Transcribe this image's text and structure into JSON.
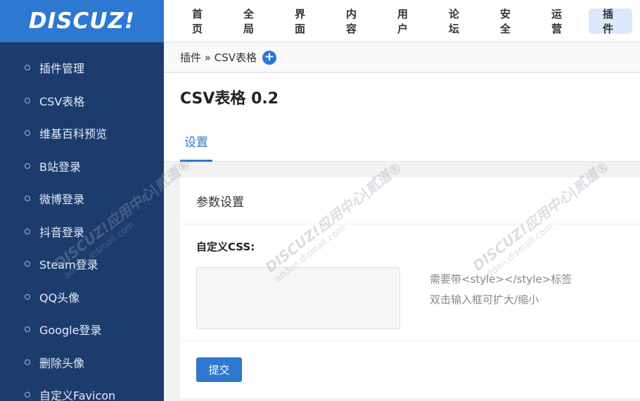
{
  "sidebar": {
    "logo": "DISCUZ!",
    "items": [
      {
        "label": "插件管理"
      },
      {
        "label": "CSV表格"
      },
      {
        "label": "维基百科预览"
      },
      {
        "label": "B站登录"
      },
      {
        "label": "微博登录"
      },
      {
        "label": "抖音登录"
      },
      {
        "label": "Steam登录"
      },
      {
        "label": "QQ头像"
      },
      {
        "label": "Google登录"
      },
      {
        "label": "删除头像"
      },
      {
        "label": "自定义Favicon"
      }
    ]
  },
  "topnav": {
    "items": [
      {
        "label": "首页"
      },
      {
        "label": "全局"
      },
      {
        "label": "界面"
      },
      {
        "label": "内容"
      },
      {
        "label": "用户"
      },
      {
        "label": "论坛"
      },
      {
        "label": "安全"
      },
      {
        "label": "运营"
      },
      {
        "label": "插件",
        "active": true
      }
    ]
  },
  "breadcrumb": {
    "text": "插件 » CSV表格",
    "add_icon": "plus-circle-icon",
    "add_symbol": "+"
  },
  "page": {
    "title": "CSV表格 0.2",
    "tab": "设置"
  },
  "panel": {
    "heading": "参数设置",
    "field_label": "自定义CSS:",
    "textarea_value": "",
    "hint1": "需要带<style></style>标签",
    "hint2": "双击输入框可扩大/缩小",
    "submit_label": "提交"
  },
  "watermark": {
    "brand": "DISCUZ!应用中心|贰道®",
    "site": "addon.dismall.com"
  },
  "colors": {
    "sidebar_bg": "#1c3c6e",
    "logo_bg": "#2d78d0",
    "accent": "#2d78d0",
    "active_nav_bg": "#dde9fb"
  }
}
